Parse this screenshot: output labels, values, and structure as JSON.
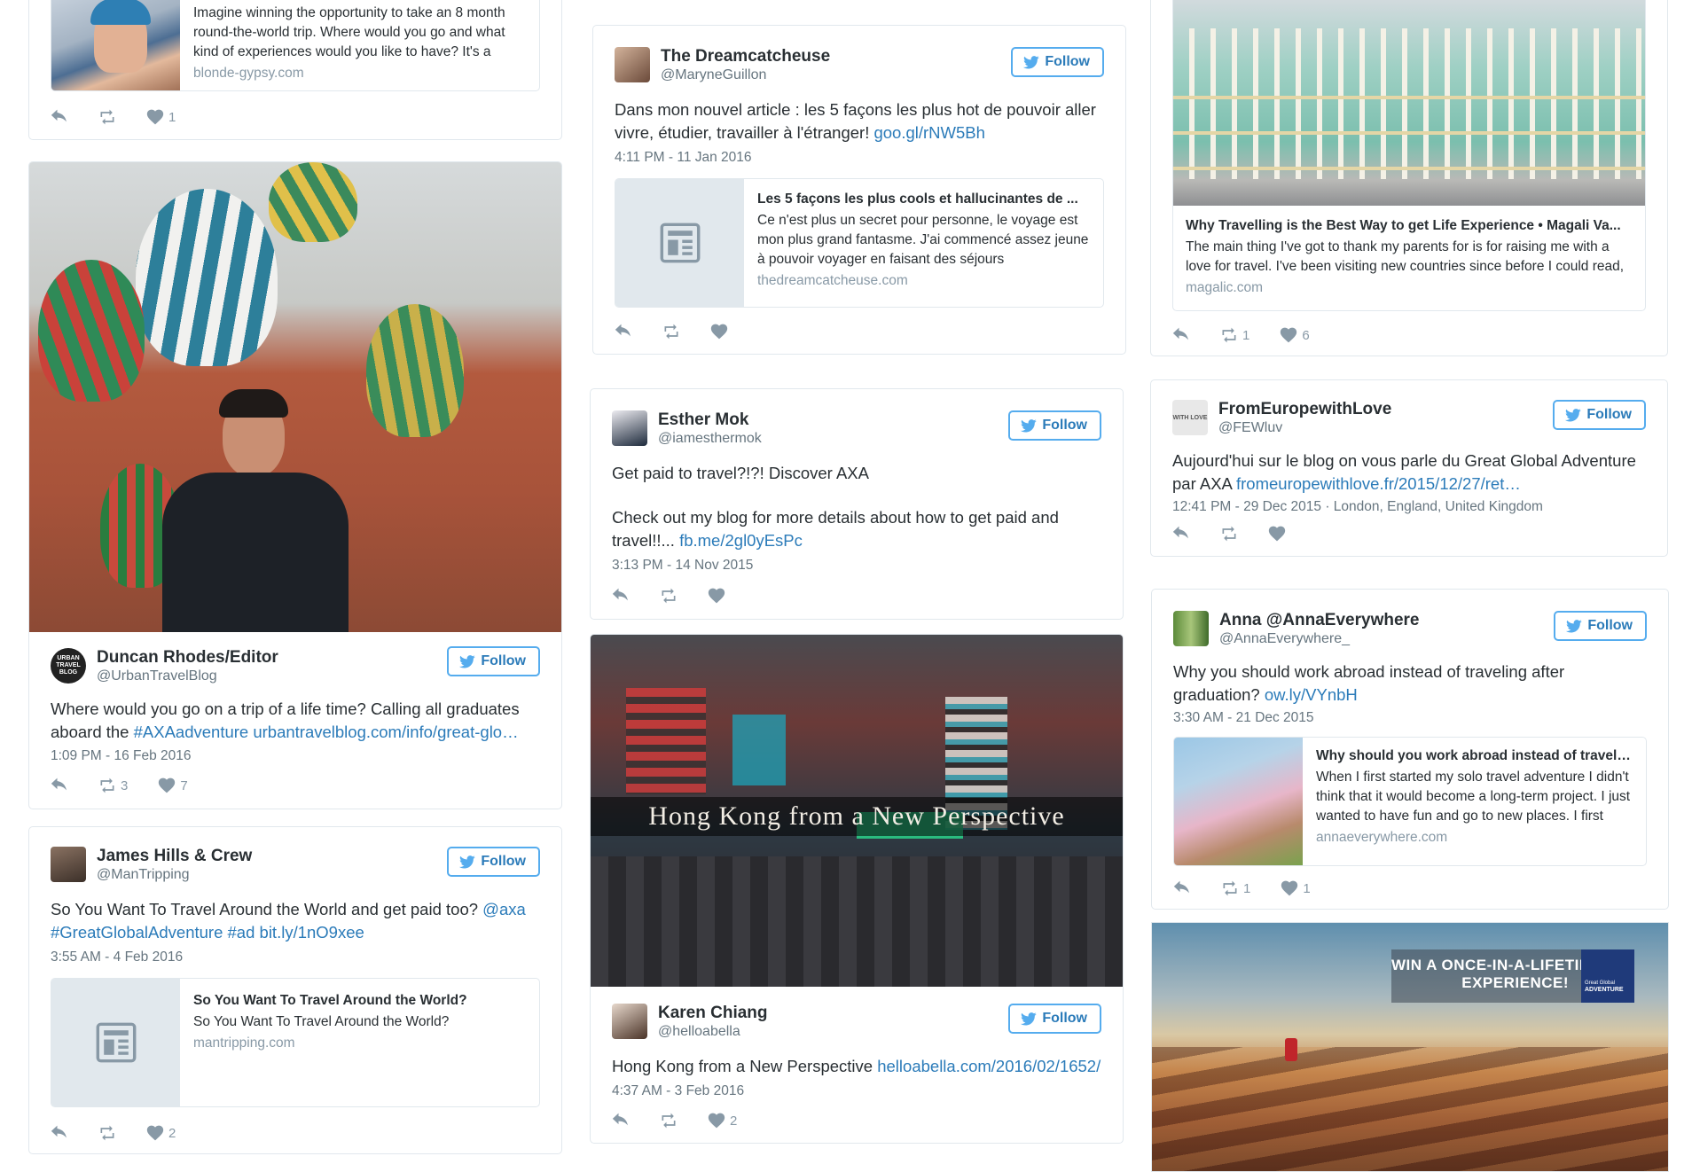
{
  "follow_label": "Follow",
  "c1": {
    "t1": {
      "text": "Imagine winning the opportunity to take an 8 month round-the-world trip. Where would you go and what kind of experiences would you like to have? It's a",
      "domain": "blonde-gypsy.com",
      "like_count": "1"
    },
    "t2": {
      "name": "Duncan Rhodes/Editor",
      "handle": "@UrbanTravelBlog",
      "avatar_text": "URBAN TRAVEL BLOG",
      "text": "Where would you go on a trip of a life time? Calling all graduates aboard the ",
      "hashtag": "#AXAadventure",
      "url": "urbantravelblog.com/info/great-glo…",
      "time": "1:09 PM - 16 Feb 2016",
      "retweet_count": "3",
      "like_count": "7"
    },
    "t3": {
      "name": "James Hills & Crew",
      "handle": "@ManTripping",
      "text": "So You Want To Travel Around the World and get paid too? ",
      "mention": "@axa",
      "hashtag": "#GreatGlobalAdventure",
      "hashtag2": "#ad",
      "url": "bit.ly/1nO9xee",
      "time": "3:55 AM - 4 Feb 2016",
      "preview_title": "So You Want To Travel Around the World?",
      "preview_desc": "So You Want To Travel Around the World?",
      "preview_domain": "mantripping.com",
      "like_count": "2"
    }
  },
  "c2": {
    "t1": {
      "name": "The Dreamcatcheuse",
      "handle": "@MaryneGuillon",
      "text": "Dans mon nouvel article : les 5 façons les plus hot de pouvoir aller vivre, étudier, travailler à l'étranger! ",
      "url": "goo.gl/rNW5Bh",
      "time": "4:11 PM - 11 Jan 2016",
      "preview_title": "Les 5 façons les plus cools et hallucinantes de ...",
      "preview_desc": "Ce n'est plus un secret pour personne, le voyage est mon plus grand fantasme. J'ai commencé assez jeune à pouvoir voyager en faisant des séjours",
      "preview_domain": "thedreamcatcheuse.com"
    },
    "t2": {
      "name": "Esther Mok",
      "handle": "@iamesthermok",
      "line1": "Get paid to travel?!?! Discover AXA",
      "line2": "Check out my blog for more details about how to get paid and travel!!... ",
      "url": "fb.me/2gl0yEsPc",
      "time": "3:13 PM - 14 Nov 2015"
    },
    "t3": {
      "photo_caption": "Hong Kong from a New Perspective",
      "name": "Karen Chiang",
      "handle": "@helloabella",
      "text": "Hong Kong from a New Perspective ",
      "url": "helloabella.com/2016/02/1652/",
      "time": "4:37 AM - 3 Feb 2016",
      "like_count": "2"
    }
  },
  "c3": {
    "t1": {
      "preview_title": "Why Travelling is the Best Way to get Life Experience • Magali Va...",
      "preview_desc": "The main thing I've got to thank my parents for is for raising me with a love for travel. I've been visiting new countries since before I could read,",
      "preview_domain": "magalic.com",
      "retweet_count": "1",
      "like_count": "6"
    },
    "t2": {
      "name": "FromEuropewithLove",
      "handle": "@FEWluv",
      "avatar_text": "WITH LOVE",
      "text": "Aujourd'hui sur le blog on vous parle du Great Global Adventure par AXA ",
      "url": "fromeuropewithlove.fr/2015/12/27/ret…",
      "time": "12:41 PM - 29 Dec 2015 · London, England, United Kingdom"
    },
    "t3": {
      "name": "Anna @AnnaEverywhere",
      "handle": "@AnnaEverywhere_",
      "text": "Why you should work abroad instead of traveling after graduation? ",
      "url": "ow.ly/VYnbH",
      "time": "3:30 AM - 21 Dec 2015",
      "preview_title": "Why should you work abroad instead of travelli...",
      "preview_desc": "When I first started my solo travel adventure I didn't think that it would become a long-term project. I just wanted to have fun and go to new places. I first",
      "preview_domain": "annaeverywhere.com",
      "retweet_count": "1",
      "like_count": "1"
    },
    "ad": {
      "line1": "WIN A  ONCE-IN-A-LIFETIME",
      "line2": "EXPERIENCE!",
      "brand_small": "Great Global",
      "brand_big": "ADVENTURE"
    }
  }
}
